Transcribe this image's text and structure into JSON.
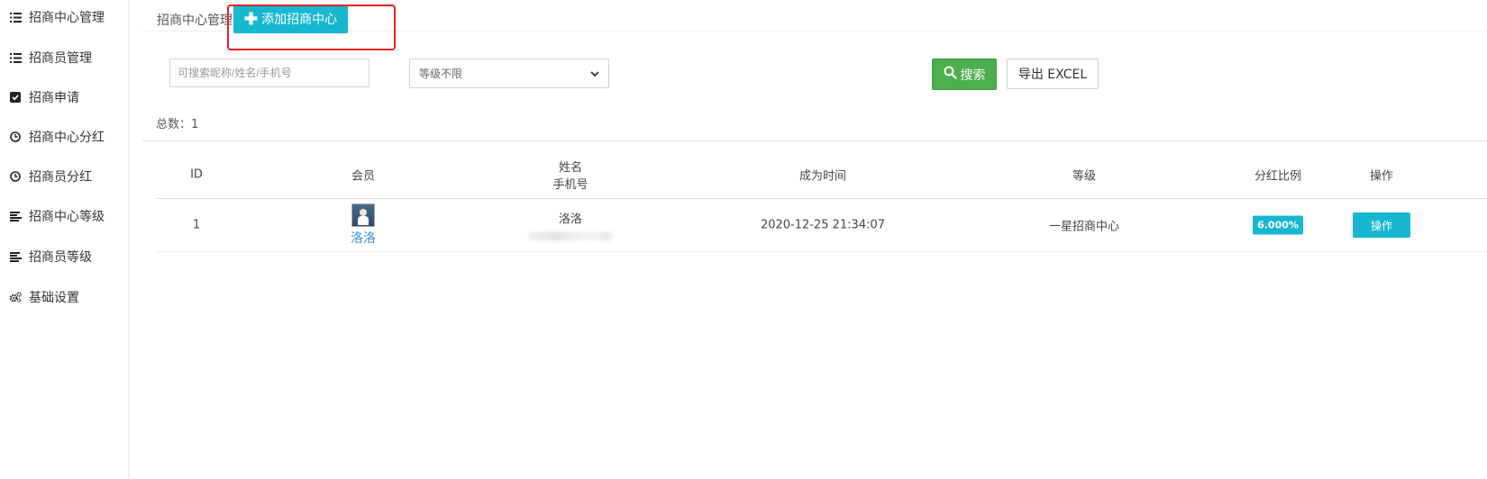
{
  "sidebar": {
    "items": [
      {
        "label": "招商中心管理",
        "icon": "list-icon"
      },
      {
        "label": "招商员管理",
        "icon": "list-icon"
      },
      {
        "label": "招商申请",
        "icon": "check-square-icon"
      },
      {
        "label": "招商中心分红",
        "icon": "clock-icon"
      },
      {
        "label": "招商员分红",
        "icon": "clock-icon"
      },
      {
        "label": "招商中心等级",
        "icon": "align-left-icon"
      },
      {
        "label": "招商员等级",
        "icon": "align-left-icon"
      },
      {
        "label": "基础设置",
        "icon": "gears-icon"
      }
    ]
  },
  "header": {
    "breadcrumb": "招商中心管理",
    "add_button": "添加招商中心"
  },
  "filters": {
    "search_placeholder": "可搜索昵称/姓名/手机号",
    "level_select": "等级不限",
    "search_button": "搜索",
    "export_button": "导出 EXCEL"
  },
  "summary": {
    "total_label": "总数：1"
  },
  "table": {
    "headers": {
      "id": "ID",
      "member": "会员",
      "name": "姓名",
      "phone": "手机号",
      "time": "成为时间",
      "level": "等级",
      "ratio": "分红比例",
      "action": "操作"
    },
    "rows": [
      {
        "id": "1",
        "member": "洛洛",
        "name": "洛洛",
        "time": "2020-12-25 21:34:07",
        "level": "一星招商中心",
        "ratio": "6.000%",
        "action": "操作"
      }
    ]
  },
  "colors": {
    "accent": "#17b7d0",
    "success": "#4cae4c",
    "highlight": "#e8202a"
  }
}
